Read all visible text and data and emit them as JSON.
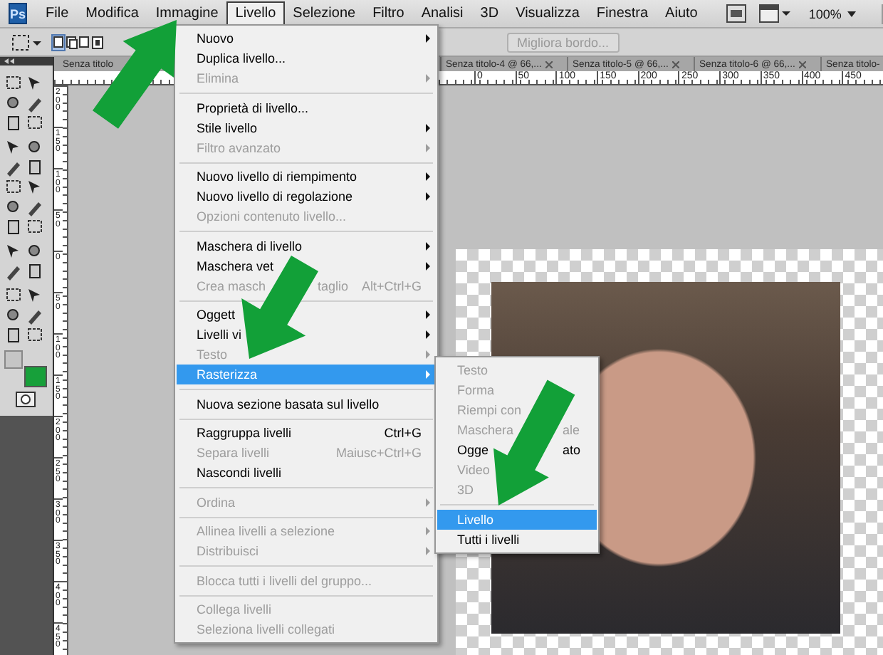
{
  "menubar": {
    "logo": "Ps",
    "zoom": "100%",
    "menus": [
      {
        "label": "File",
        "selected": false
      },
      {
        "label": "Modifica",
        "selected": false
      },
      {
        "label": "Immagine",
        "selected": false
      },
      {
        "label": "Livello",
        "selected": true
      },
      {
        "label": "Selezione",
        "selected": false
      },
      {
        "label": "Filtro",
        "selected": false
      },
      {
        "label": "Analisi",
        "selected": false
      },
      {
        "label": "3D",
        "selected": false
      },
      {
        "label": "Visualizza",
        "selected": false
      },
      {
        "label": "Finestra",
        "selected": false
      },
      {
        "label": "Aiuto",
        "selected": false
      }
    ]
  },
  "options_bar": {
    "refine_edge_button": {
      "label": "Migliora bordo...",
      "disabled": true
    }
  },
  "document_tabs": [
    {
      "label": "Senza titolo"
    },
    {
      "label": "Senza titolo-4 @ 66,..."
    },
    {
      "label": "Senza titolo-5 @ 66,..."
    },
    {
      "label": "Senza titolo-6 @ 66,..."
    },
    {
      "label": "Senza titolo-"
    }
  ],
  "rulers": {
    "horizontal": [
      "0",
      "50",
      "100",
      "150",
      "200",
      "250",
      "300",
      "350",
      "400",
      "450"
    ],
    "vertical": [
      "200",
      "150",
      "100",
      "50",
      "0",
      "50",
      "100",
      "150",
      "200",
      "250",
      "300",
      "350",
      "400",
      "450"
    ]
  },
  "layer_menu": {
    "items": [
      {
        "kind": "item",
        "label": "Nuovo",
        "submenu": true,
        "disabled": false,
        "selected": false
      },
      {
        "kind": "item",
        "label": "Duplica livello...",
        "submenu": false,
        "disabled": false,
        "selected": false
      },
      {
        "kind": "item",
        "label": "Elimina",
        "submenu": true,
        "disabled": true,
        "selected": false
      },
      {
        "kind": "separator"
      },
      {
        "kind": "item",
        "label": "Proprietà di livello...",
        "submenu": false,
        "disabled": false,
        "selected": false
      },
      {
        "kind": "item",
        "label": "Stile livello",
        "submenu": true,
        "disabled": false,
        "selected": false
      },
      {
        "kind": "item",
        "label": "Filtro avanzato",
        "submenu": true,
        "disabled": true,
        "selected": false
      },
      {
        "kind": "separator"
      },
      {
        "kind": "item",
        "label": "Nuovo livello di riempimento",
        "submenu": true,
        "disabled": false,
        "selected": false
      },
      {
        "kind": "item",
        "label": "Nuovo livello di regolazione",
        "submenu": true,
        "disabled": false,
        "selected": false
      },
      {
        "kind": "item",
        "label": "Opzioni contenuto livello...",
        "submenu": false,
        "disabled": true,
        "selected": false
      },
      {
        "kind": "separator"
      },
      {
        "kind": "item",
        "label": "Maschera di livello",
        "submenu": true,
        "disabled": false,
        "selected": false
      },
      {
        "kind": "item",
        "label": "Maschera vet",
        "submenu": true,
        "disabled": false,
        "selected": false
      },
      {
        "kind": "item",
        "label": "Crea masch",
        "tail": "taglio",
        "shortcut": "Alt+Ctrl+G",
        "submenu": false,
        "disabled": true,
        "selected": false
      },
      {
        "kind": "separator"
      },
      {
        "kind": "item",
        "label": "Oggett",
        "submenu": true,
        "disabled": false,
        "selected": false
      },
      {
        "kind": "item",
        "label": "Livelli vi",
        "submenu": true,
        "disabled": false,
        "selected": false
      },
      {
        "kind": "item",
        "label": "Testo",
        "submenu": true,
        "disabled": true,
        "selected": false
      },
      {
        "kind": "item",
        "label": "Rasterizza",
        "submenu": true,
        "disabled": false,
        "selected": true
      },
      {
        "kind": "separator"
      },
      {
        "kind": "item",
        "label": "Nuova sezione basata sul livello",
        "submenu": false,
        "disabled": false,
        "selected": false
      },
      {
        "kind": "separator"
      },
      {
        "kind": "item",
        "label": "Raggruppa livelli",
        "shortcut": "Ctrl+G",
        "submenu": false,
        "disabled": false,
        "selected": false
      },
      {
        "kind": "item",
        "label": "Separa livelli",
        "shortcut": "Maiusc+Ctrl+G",
        "submenu": false,
        "disabled": true,
        "selected": false
      },
      {
        "kind": "item",
        "label": "Nascondi livelli",
        "submenu": false,
        "disabled": false,
        "selected": false
      },
      {
        "kind": "separator"
      },
      {
        "kind": "item",
        "label": "Ordina",
        "submenu": true,
        "disabled": true,
        "selected": false
      },
      {
        "kind": "separator"
      },
      {
        "kind": "item",
        "label": "Allinea livelli a selezione",
        "submenu": true,
        "disabled": true,
        "selected": false
      },
      {
        "kind": "item",
        "label": "Distribuisci",
        "submenu": true,
        "disabled": true,
        "selected": false
      },
      {
        "kind": "separator"
      },
      {
        "kind": "item",
        "label": "Blocca tutti i livelli del gruppo...",
        "submenu": false,
        "disabled": true,
        "selected": false
      },
      {
        "kind": "separator"
      },
      {
        "kind": "item",
        "label": "Collega livelli",
        "submenu": false,
        "disabled": true,
        "selected": false
      },
      {
        "kind": "item",
        "label": "Seleziona livelli collegati",
        "submenu": false,
        "disabled": true,
        "selected": false
      }
    ]
  },
  "rasterize_submenu": {
    "items": [
      {
        "kind": "item",
        "label": "Testo",
        "disabled": true,
        "selected": false
      },
      {
        "kind": "item",
        "label": "Forma",
        "disabled": true,
        "selected": false
      },
      {
        "kind": "item",
        "label": "Riempi con",
        "disabled": true,
        "selected": false
      },
      {
        "kind": "item",
        "label": "Maschera",
        "tail": "ale",
        "disabled": true,
        "selected": false
      },
      {
        "kind": "item",
        "label": "Ogge",
        "tail": "ato",
        "disabled": false,
        "selected": false
      },
      {
        "kind": "item",
        "label": "Video",
        "disabled": true,
        "selected": false
      },
      {
        "kind": "item",
        "label": "3D",
        "disabled": true,
        "selected": false
      },
      {
        "kind": "separator"
      },
      {
        "kind": "item",
        "label": "Livello",
        "disabled": false,
        "selected": true
      },
      {
        "kind": "item",
        "label": "Tutti i livelli",
        "disabled": false,
        "selected": false
      }
    ]
  }
}
